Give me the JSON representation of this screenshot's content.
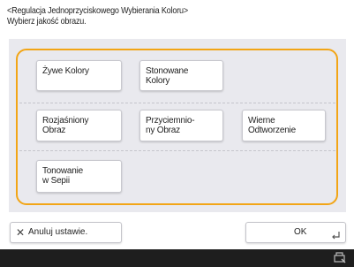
{
  "header": {
    "title": "<Regulacja Jednoprzyciskowego Wybierania Koloru>",
    "instruction": "Wybierz jakość obrazu."
  },
  "options": [
    {
      "label": "Żywe Kolory"
    },
    {
      "label": "Stonowane\nKolory"
    },
    {
      "label": "Rozjaśniony\nObraz"
    },
    {
      "label": "Przyciemnio-\nny Obraz"
    },
    {
      "label": "Wierne\nOdtworzenie"
    },
    {
      "label": "Tonowanie\nw Sepii"
    }
  ],
  "footer": {
    "cancel_label": "Anuluj ustawie.",
    "ok_label": "OK"
  },
  "icons": {
    "cancel": "close-icon",
    "ok": "enter-arrow-icon",
    "status": "device-status-icon"
  },
  "colors": {
    "frame_accent": "#f2a516",
    "panel_bg": "#e9e9ee",
    "status_bar": "#1e1e1e"
  }
}
